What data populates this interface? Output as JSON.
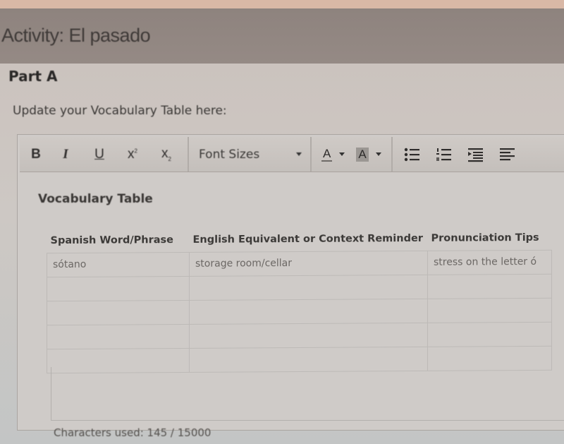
{
  "activity": {
    "title": "Activity: El pasado"
  },
  "part": {
    "title": "Part A",
    "instructions": "Update your Vocabulary Table here:"
  },
  "toolbar": {
    "bold_label": "B",
    "italic_label": "I",
    "underline_label": "U",
    "superscript_label": "x",
    "superscript_mark": "2",
    "subscript_label": "x",
    "subscript_mark": "2",
    "font_sizes_label": "Font Sizes",
    "text_color_label": "A",
    "background_color_label": "A",
    "icons": [
      "bulleted-list-icon",
      "numbered-list-icon",
      "indent-icon",
      "align-left-icon"
    ]
  },
  "editor": {
    "heading": "Vocabulary Table",
    "table": {
      "columns": [
        "Spanish Word/Phrase",
        "English Equivalent or Context Reminder",
        "Pronunciation Tips"
      ],
      "rows": [
        [
          "sótano",
          "storage room/cellar",
          "stress on the letter ó"
        ],
        [
          "",
          "",
          ""
        ],
        [
          "",
          "",
          ""
        ],
        [
          "",
          "",
          ""
        ],
        [
          "",
          "",
          ""
        ]
      ]
    },
    "character_count": "Characters used: 145 / 15000"
  }
}
